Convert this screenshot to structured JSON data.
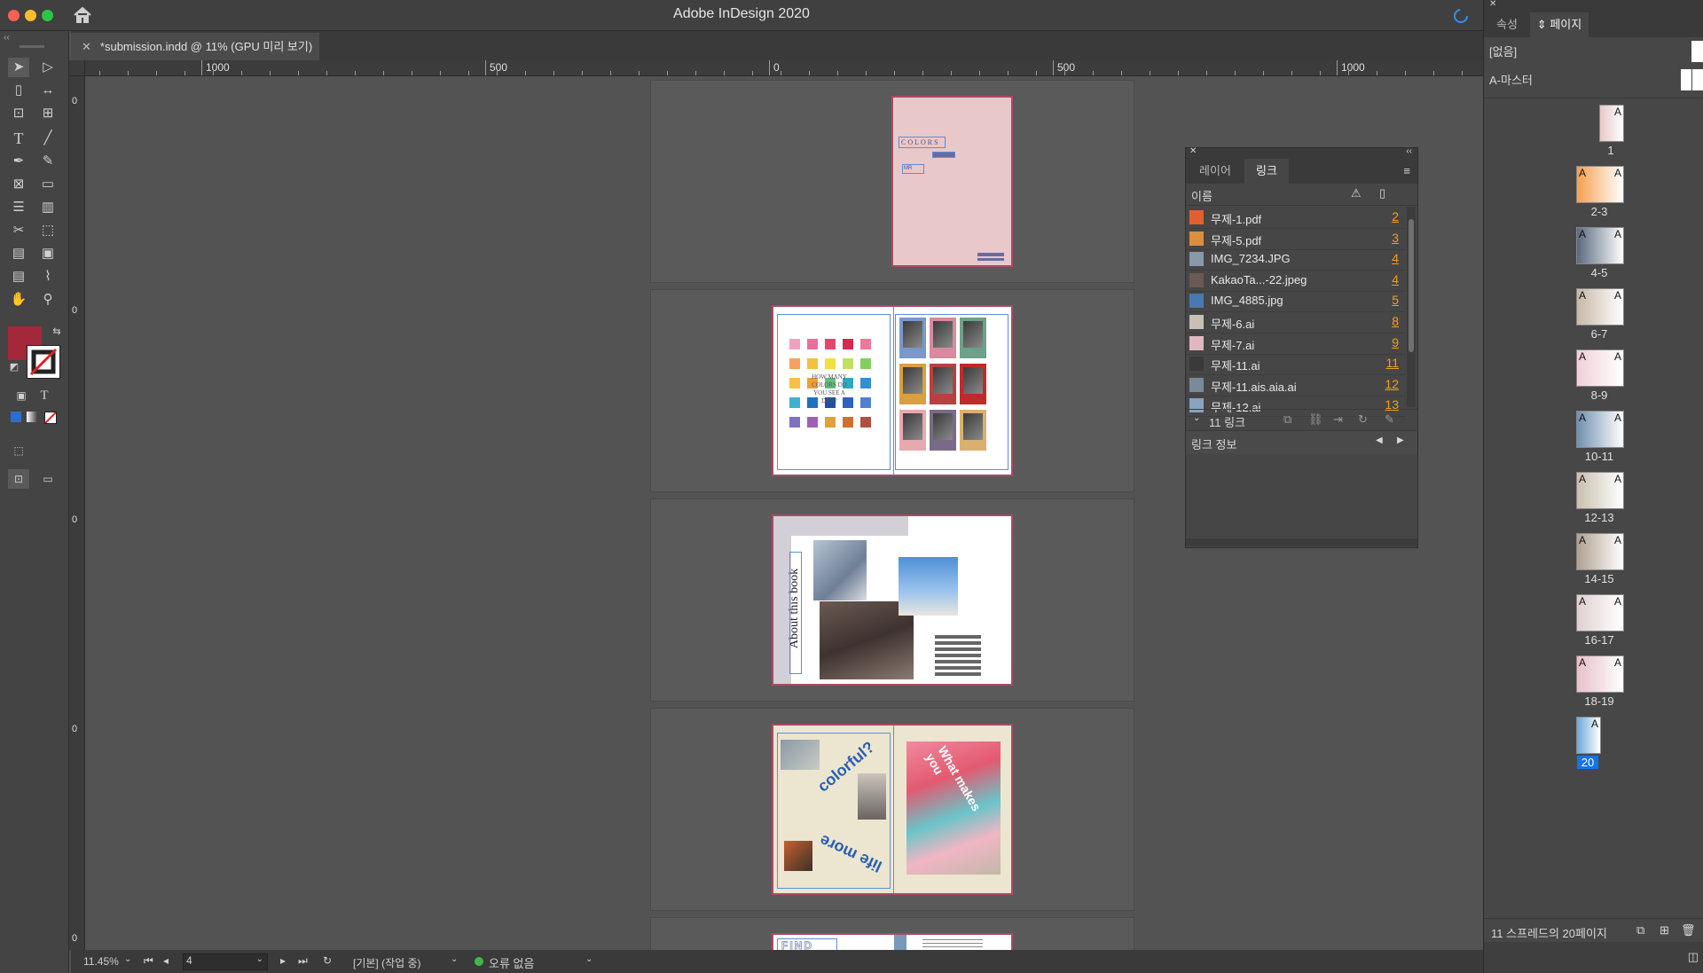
{
  "app": {
    "title": "Adobe InDesign 2020",
    "document_tab": "*submission.indd @ 11% (GPU 미리 보기)"
  },
  "ruler": {
    "labels": [
      "1000",
      "500",
      "0",
      "500",
      "1000"
    ],
    "vertical_zero": "0"
  },
  "canvas": {
    "page1": {
      "title": "COLORS",
      "tag": "MR"
    },
    "page2": {
      "left_text": "HOW MANY COLORS DO YOU SEE A DAY?"
    },
    "page3": {
      "vertical_text": "About this book"
    },
    "page4": {
      "arc_top": "colorful?",
      "arc_bottom": "life more",
      "right_arc": "What makes you"
    },
    "page5": {
      "left_title": "FIND"
    }
  },
  "status_bar": {
    "zoom": "11.45%",
    "page_field": "4",
    "mode": "[기본] (작업 중)",
    "preflight": "오류 없음"
  },
  "links_panel": {
    "tabs": [
      "레이어",
      "링크"
    ],
    "header_name": "이름",
    "items": [
      {
        "name": "무제-1.pdf",
        "page": "2"
      },
      {
        "name": "무제-5.pdf",
        "page": "3"
      },
      {
        "name": "IMG_7234.JPG",
        "page": "4"
      },
      {
        "name": "KakaoTa...-22.jpeg",
        "page": "4"
      },
      {
        "name": "IMG_4885.jpg",
        "page": "5"
      },
      {
        "name": "무제-6.ai",
        "page": "8"
      },
      {
        "name": "무제-7.ai",
        "page": "9"
      },
      {
        "name": "무제-11.ai",
        "page": "11"
      },
      {
        "name": "무제-11.ais.aia.ai",
        "page": "12"
      },
      {
        "name": "무제-12.ai",
        "page": "13"
      }
    ],
    "count_label": "11 링크",
    "info_label": "링크 정보"
  },
  "pages_panel": {
    "tabs": [
      "속성",
      "페이지"
    ],
    "masters": [
      "[없음]",
      "A-마스터"
    ],
    "page_labels": [
      "1",
      "2-3",
      "4-5",
      "6-7",
      "8-9",
      "10-11",
      "12-13",
      "14-15",
      "16-17",
      "18-19",
      "20"
    ],
    "master_letter": "A",
    "footer": "11 스프레드의 20페이지"
  },
  "colors": {
    "fill_swatch": "#a3283a",
    "page_border": "#a94a66",
    "selected_page": "#1473e6",
    "link_page": "#f0a020"
  }
}
